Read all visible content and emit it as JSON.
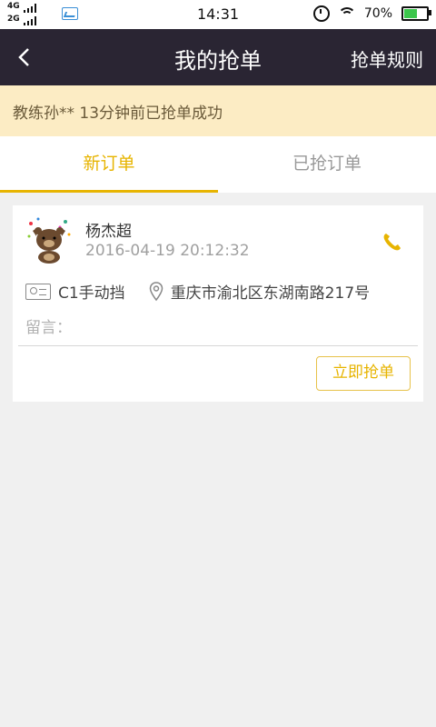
{
  "status_bar": {
    "network_top": "4G",
    "network_bottom": "2G",
    "time": "14:31",
    "battery": "70%",
    "battery_level": 0.7,
    "battery_color": "#3bc64b"
  },
  "header": {
    "title": "我的抢单",
    "rules_label": "抢单规则",
    "back_icon": "chevron-left-icon"
  },
  "notice": {
    "text": "教练孙** 13分钟前已抢单成功"
  },
  "tabs": [
    {
      "label": "新订单",
      "active": true
    },
    {
      "label": "已抢订单",
      "active": false
    }
  ],
  "order": {
    "name": "杨杰超",
    "time": "2016-04-19 20:12:32",
    "license": "C1手动挡",
    "address": "重庆市渝北区东湖南路217号",
    "message_label": "留言：",
    "grab_button": "立即抢单",
    "phone_icon": "phone-icon"
  },
  "colors": {
    "accent": "#e7b400",
    "header_bg": "#2a2533",
    "notice_bg": "#fcecc4"
  }
}
